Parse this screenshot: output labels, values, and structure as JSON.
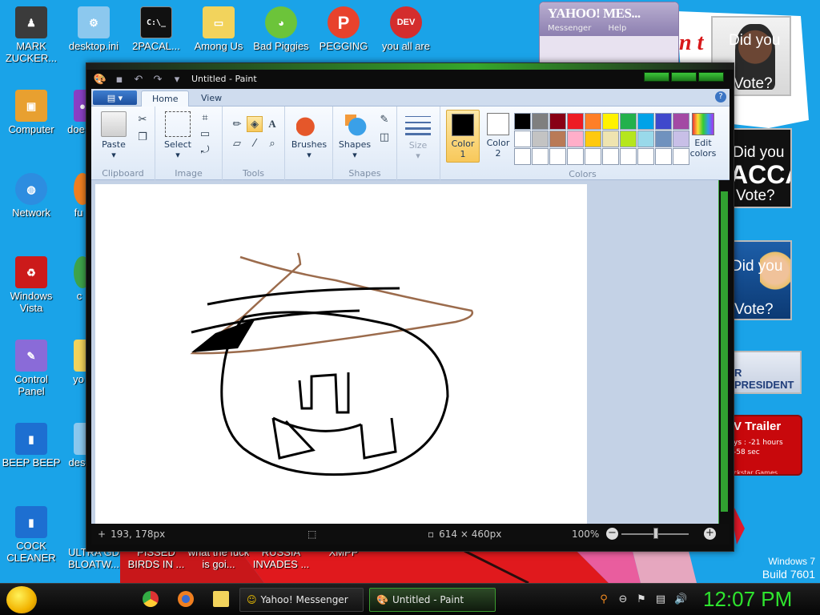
{
  "desktop": {
    "icons": [
      {
        "label": "MARK ZUCKER...",
        "icon": "man-figure-icon",
        "color": "#3b3b3b"
      },
      {
        "label": "desktop.ini",
        "icon": "settings-file-icon",
        "color": "#8cc8ee"
      },
      {
        "label": "2PACAL...",
        "icon": "cmd-icon",
        "color": "#111111"
      },
      {
        "label": "Among Us",
        "icon": "folder-icon",
        "color": "#f2d35c"
      },
      {
        "label": "Bad Piggies",
        "icon": "pig-icon",
        "color": "#6cc43a"
      },
      {
        "label": "PEGGING",
        "icon": "peg-p-icon",
        "color": "#e8422c"
      },
      {
        "label": "you all are",
        "icon": "dev-cpp-icon",
        "color": "#d42d2d"
      },
      {
        "label": "Computer",
        "icon": "computer-icon",
        "color": "#e8a030"
      },
      {
        "label": "doe",
        "icon": "app-icon",
        "color": "#8a3fc4"
      },
      {
        "label": "Network",
        "icon": "network-globe-icon",
        "color": "#2d8de0"
      },
      {
        "label": "fu",
        "icon": "firefox-icon",
        "color": "#f07f20"
      },
      {
        "label": "Windows Vista",
        "icon": "recycle-bin-icon",
        "color": "#cc1a1a"
      },
      {
        "label": "c",
        "icon": "chrome-icon",
        "color": "#3ea34a"
      },
      {
        "label": "Control Panel",
        "icon": "control-panel-icon",
        "color": "#8a6bd8"
      },
      {
        "label": "yo",
        "icon": "folder-icon",
        "color": "#f2d35c"
      },
      {
        "label": "BEEP BEEP",
        "icon": "blue-file-icon",
        "color": "#1d6fd1"
      },
      {
        "label": "des",
        "icon": "file-icon",
        "color": "#8cc8ee"
      },
      {
        "label": "COCK CLEANER",
        "icon": "blue-file-icon",
        "color": "#1d6fd1"
      }
    ],
    "bottom_labels": [
      "ULTRA GD BLOATW...",
      "PISSED BIRDS IN ...",
      "what the fuck is goi...",
      "RUSSIA INVADES ...",
      "XMPP"
    ],
    "ads": {
      "ad1_text": "Did you",
      "ad1_sub": "Vote?",
      "ad2_text": "Did you",
      "ad2_big": "ACCA",
      "ad2_sub": "Vote?",
      "ad3_text": "Did you",
      "ad3_sub": "Vote?",
      "president_text": "R PRESIDENT",
      "trailer_title": "V Trailer",
      "trailer_line1": "ys : -21 hours",
      "trailer_line2": "-58 sec",
      "trailer_brand": "ckstar Games",
      "red_text": "n t"
    },
    "windows_badge": {
      "line1": "Windows 7",
      "line2": "Build 7601"
    }
  },
  "yahoo": {
    "title": "YAHOO! MES...",
    "menu": [
      "Messenger",
      "Help"
    ]
  },
  "paint": {
    "window_title": "Untitled - Paint",
    "tabs": [
      "Home",
      "View"
    ],
    "help": "?",
    "groups": {
      "clipboard": {
        "label": "Clipboard",
        "paste": "Paste"
      },
      "image": {
        "label": "Image",
        "select": "Select"
      },
      "tools": {
        "label": "Tools"
      },
      "brushes": {
        "label": "Brushes"
      },
      "shapes": {
        "label": "Shapes",
        "shapes_btn": "Shapes"
      },
      "size": {
        "label": "Size"
      },
      "colors": {
        "label": "Colors",
        "color1": "Color\n1",
        "color2": "Color\n2",
        "edit": "Edit colors"
      }
    },
    "color1_value": "#000000",
    "color2_value": "#ffffff",
    "palette": [
      "#000000",
      "#7f7f7f",
      "#880015",
      "#ed1c24",
      "#ff7f27",
      "#fff200",
      "#22b14c",
      "#00a2e8",
      "#3f48cc",
      "#a349a4",
      "#ffffff",
      "#c3c3c3",
      "#b97a57",
      "#ffaec9",
      "#ffc90e",
      "#efe4b0",
      "#b5e61d",
      "#99d9ea",
      "#7092be",
      "#c8bfe7",
      "#ffffff",
      "#ffffff",
      "#ffffff",
      "#ffffff",
      "#ffffff",
      "#ffffff",
      "#ffffff",
      "#ffffff",
      "#ffffff",
      "#ffffff"
    ],
    "status": {
      "cursor_pos": "193, 178px",
      "canvas_size": "614 × 460px",
      "zoom": "100%"
    }
  },
  "taskbar": {
    "tasks": [
      {
        "label": "Yahoo! Messenger"
      },
      {
        "label": "Untitled - Paint"
      }
    ],
    "clock": "12:07 PM"
  }
}
